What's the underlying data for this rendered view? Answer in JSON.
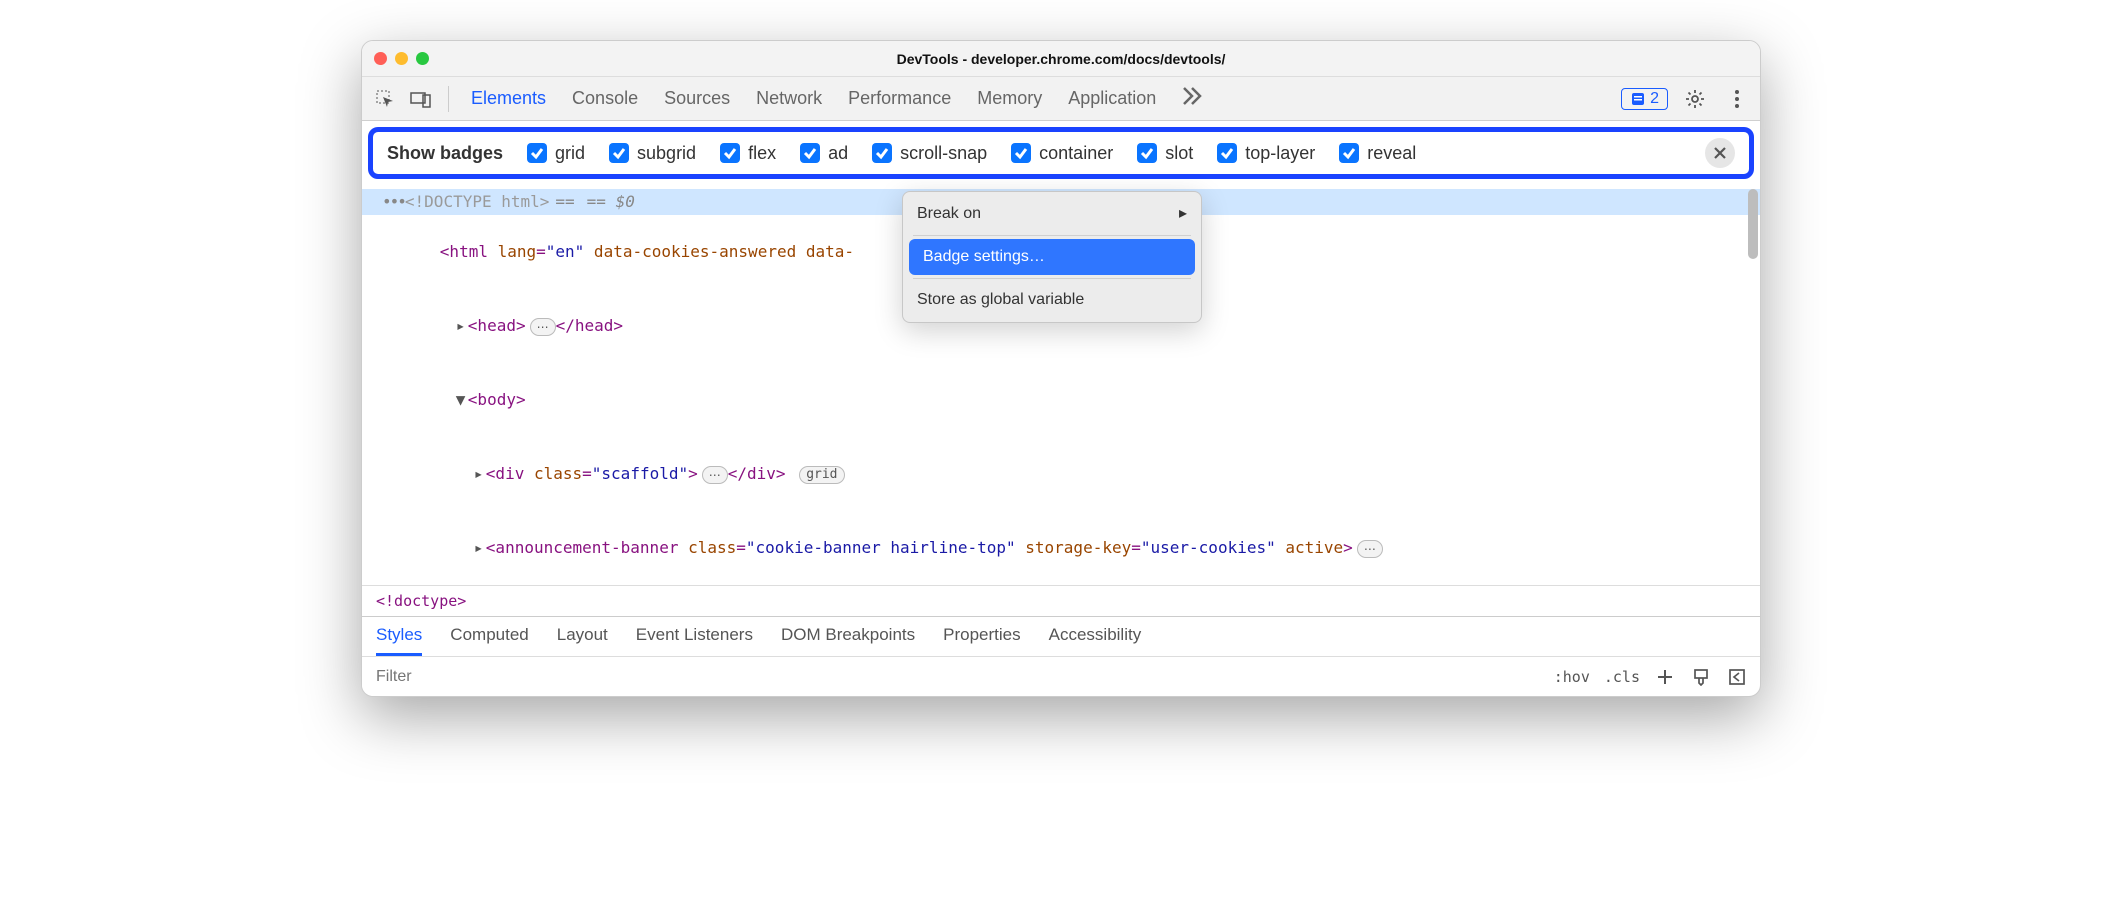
{
  "window_title": "DevTools - developer.chrome.com/docs/devtools/",
  "toolbar": {
    "tabs": [
      "Elements",
      "Console",
      "Sources",
      "Network",
      "Performance",
      "Memory",
      "Application"
    ],
    "active_tab_index": 0,
    "issue_count": "2"
  },
  "badge_bar": {
    "label": "Show badges",
    "badges": [
      "grid",
      "subgrid",
      "flex",
      "ad",
      "scroll-snap",
      "container",
      "slot",
      "top-layer",
      "reveal"
    ]
  },
  "dom": {
    "doctype_text": "<!DOCTYPE html>",
    "sel_indicator": "== $0",
    "html_open_prefix": "<html ",
    "html_lang_attr": "lang",
    "html_lang_val": "\"en\"",
    "html_rest": " data-cookies-answered data-",
    "head_open": "<head>",
    "head_close": "</head>",
    "body_open": "<body>",
    "div_open_prefix": "<div ",
    "div_class_attr": "class",
    "div_class_val": "\"scaffold\"",
    "div_close": "</div>",
    "div_badge": "grid",
    "ann_open": "<announcement-banner ",
    "ann_class_attr": "class",
    "ann_class_val": "\"cookie-banner hairline-top\"",
    "ann_storage_attr": "storage-key",
    "ann_storage_val": "\"user-cookies\"",
    "ann_active": " active",
    "breadcrumb": "<!doctype>"
  },
  "context_menu": {
    "items": [
      "Break on",
      "Badge settings…",
      "Store as global variable"
    ],
    "highlighted_index": 1,
    "has_submenu_index": 0
  },
  "styles_tabs": [
    "Styles",
    "Computed",
    "Layout",
    "Event Listeners",
    "DOM Breakpoints",
    "Properties",
    "Accessibility"
  ],
  "styles_active_index": 0,
  "filter_placeholder": "Filter",
  "filter_right": {
    "hov": ":hov",
    "cls": ".cls"
  }
}
